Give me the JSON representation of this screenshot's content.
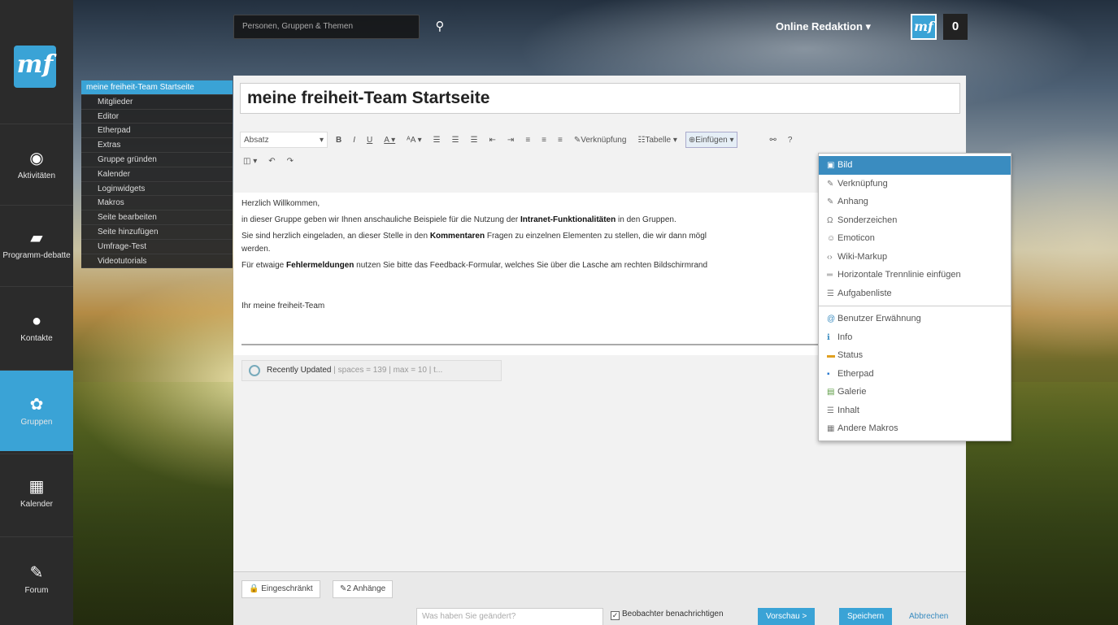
{
  "search": {
    "placeholder": "Personen, Gruppen & Themen",
    "icon": "search-icon"
  },
  "user": {
    "name": "Online Redaktion ▾",
    "avatar_text": "mf",
    "notifications": "0"
  },
  "logo": {
    "text": "mf"
  },
  "nav": [
    {
      "label": "Aktivitäten",
      "icon": "activity-icon"
    },
    {
      "label": "Programm-debatte",
      "icon": "chat-icon"
    },
    {
      "label": "Kontakte",
      "icon": "contacts-icon"
    },
    {
      "label": "Gruppen",
      "icon": "groups-icon"
    },
    {
      "label": "Kalender",
      "icon": "calendar-icon"
    },
    {
      "label": "Forum",
      "icon": "pencil-icon"
    }
  ],
  "submenu": [
    "meine freiheit-Team Startseite",
    "Mitglieder",
    "Editor",
    "Etherpad",
    "Extras",
    "Gruppe gründen",
    "Kalender",
    "Loginwidgets",
    "Makros",
    "Seite bearbeiten",
    "Seite hinzufügen",
    "Umfrage-Test",
    "Videotutorials"
  ],
  "editor": {
    "title": "meine freiheit-Team Startseite",
    "toolbar": {
      "format": "Absatz",
      "link": "✎Verknüpfung",
      "table": "☷Tabelle ▾",
      "insert": "⊕Einfügen ▾",
      "help": "?"
    },
    "content": {
      "p1": "Herzlich Willkommen,",
      "p2a": "in dieser Gruppe geben wir Ihnen anschauliche Beispiele für die Nutzung der ",
      "p2b": "Intranet-Funktionalitäten",
      "p2c": " in den Gruppen.",
      "p3a": "Sie sind herzlich eingeladen, an dieser Stelle in den ",
      "p3b": "Kommentaren",
      "p3c": " Fragen zu einzelnen Elementen zu stellen, die wir dann mögl",
      "p3d": "werden.",
      "p4a": "Für etwaige ",
      "p4b": "Fehlermeldungen",
      "p4c": " nutzen Sie bitte das Feedback-Formular, welches Sie über die Lasche am rechten Bildschirmrand",
      "p5": "Ihr meine freiheit-Team"
    },
    "macro": {
      "title": "Recently Updated",
      "meta": " | spaces = 139 | max = 10 | t..."
    }
  },
  "footer": {
    "restricted": "🔒 Eingeschränkt",
    "attachments": "✎2 Anhänge",
    "change_placeholder": "Was haben Sie geändert?",
    "watch": "Beobachter benachrichtigen",
    "preview": "Vorschau >",
    "save": "Speichern",
    "cancel": "Abbrechen"
  },
  "insert_menu": {
    "group1": [
      {
        "label": "Bild",
        "icon": "image-icon",
        "glyph": "▣"
      },
      {
        "label": "Verknüpfung",
        "icon": "link-icon",
        "glyph": "✎"
      },
      {
        "label": "Anhang",
        "icon": "attachment-icon",
        "glyph": "✎"
      },
      {
        "label": "Sonderzeichen",
        "icon": "omega-icon",
        "glyph": "Ω"
      },
      {
        "label": "Emoticon",
        "icon": "smiley-icon",
        "glyph": "☺"
      },
      {
        "label": "Wiki-Markup",
        "icon": "markup-icon",
        "glyph": "‹›"
      },
      {
        "label": "Horizontale Trennlinie einfügen",
        "icon": "hr-icon",
        "glyph": "═"
      },
      {
        "label": "Aufgabenliste",
        "icon": "tasklist-icon",
        "glyph": "☰"
      }
    ],
    "group2": [
      {
        "label": "Benutzer Erwähnung",
        "icon": "mention-icon",
        "glyph": "@"
      },
      {
        "label": "Info",
        "icon": "info-icon",
        "glyph": "ℹ"
      },
      {
        "label": "Status",
        "icon": "status-icon",
        "glyph": "▬"
      },
      {
        "label": "Etherpad",
        "icon": "etherpad-icon",
        "glyph": "▪"
      },
      {
        "label": "Galerie",
        "icon": "gallery-icon",
        "glyph": "▤"
      },
      {
        "label": "Inhalt",
        "icon": "toc-icon",
        "glyph": "☰"
      },
      {
        "label": "Andere Makros",
        "icon": "macros-icon",
        "glyph": "▦"
      }
    ]
  }
}
